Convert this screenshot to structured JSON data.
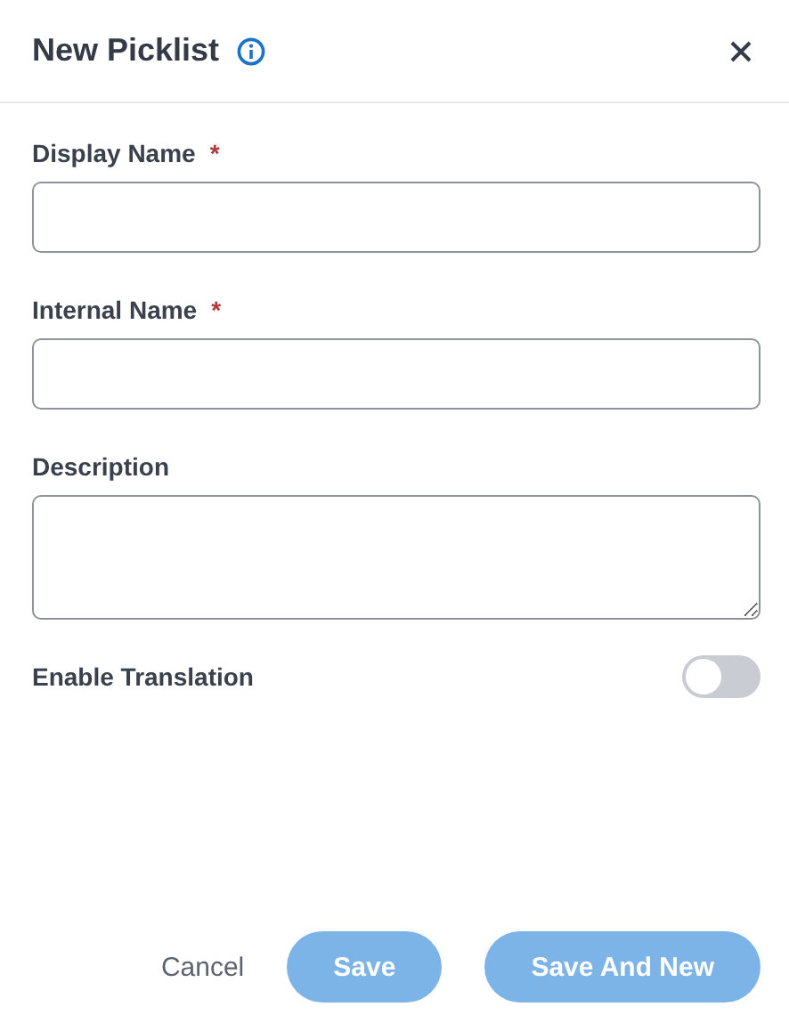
{
  "dialog": {
    "title": "New Picklist"
  },
  "fields": [
    {
      "kind": "text",
      "label": "Display Name",
      "required_mark": "*"
    },
    {
      "kind": "text",
      "label": "Internal Name",
      "required_mark": "*"
    },
    {
      "kind": "textarea",
      "label": "Description"
    }
  ],
  "toggle": {
    "label": "Enable Translation",
    "on": false
  },
  "buttons": [
    {
      "kind": "link",
      "label": "Cancel"
    },
    {
      "kind": "primary",
      "label": "Save",
      "disabled": true
    },
    {
      "kind": "primary",
      "label": "Save And New",
      "disabled": true
    }
  ]
}
